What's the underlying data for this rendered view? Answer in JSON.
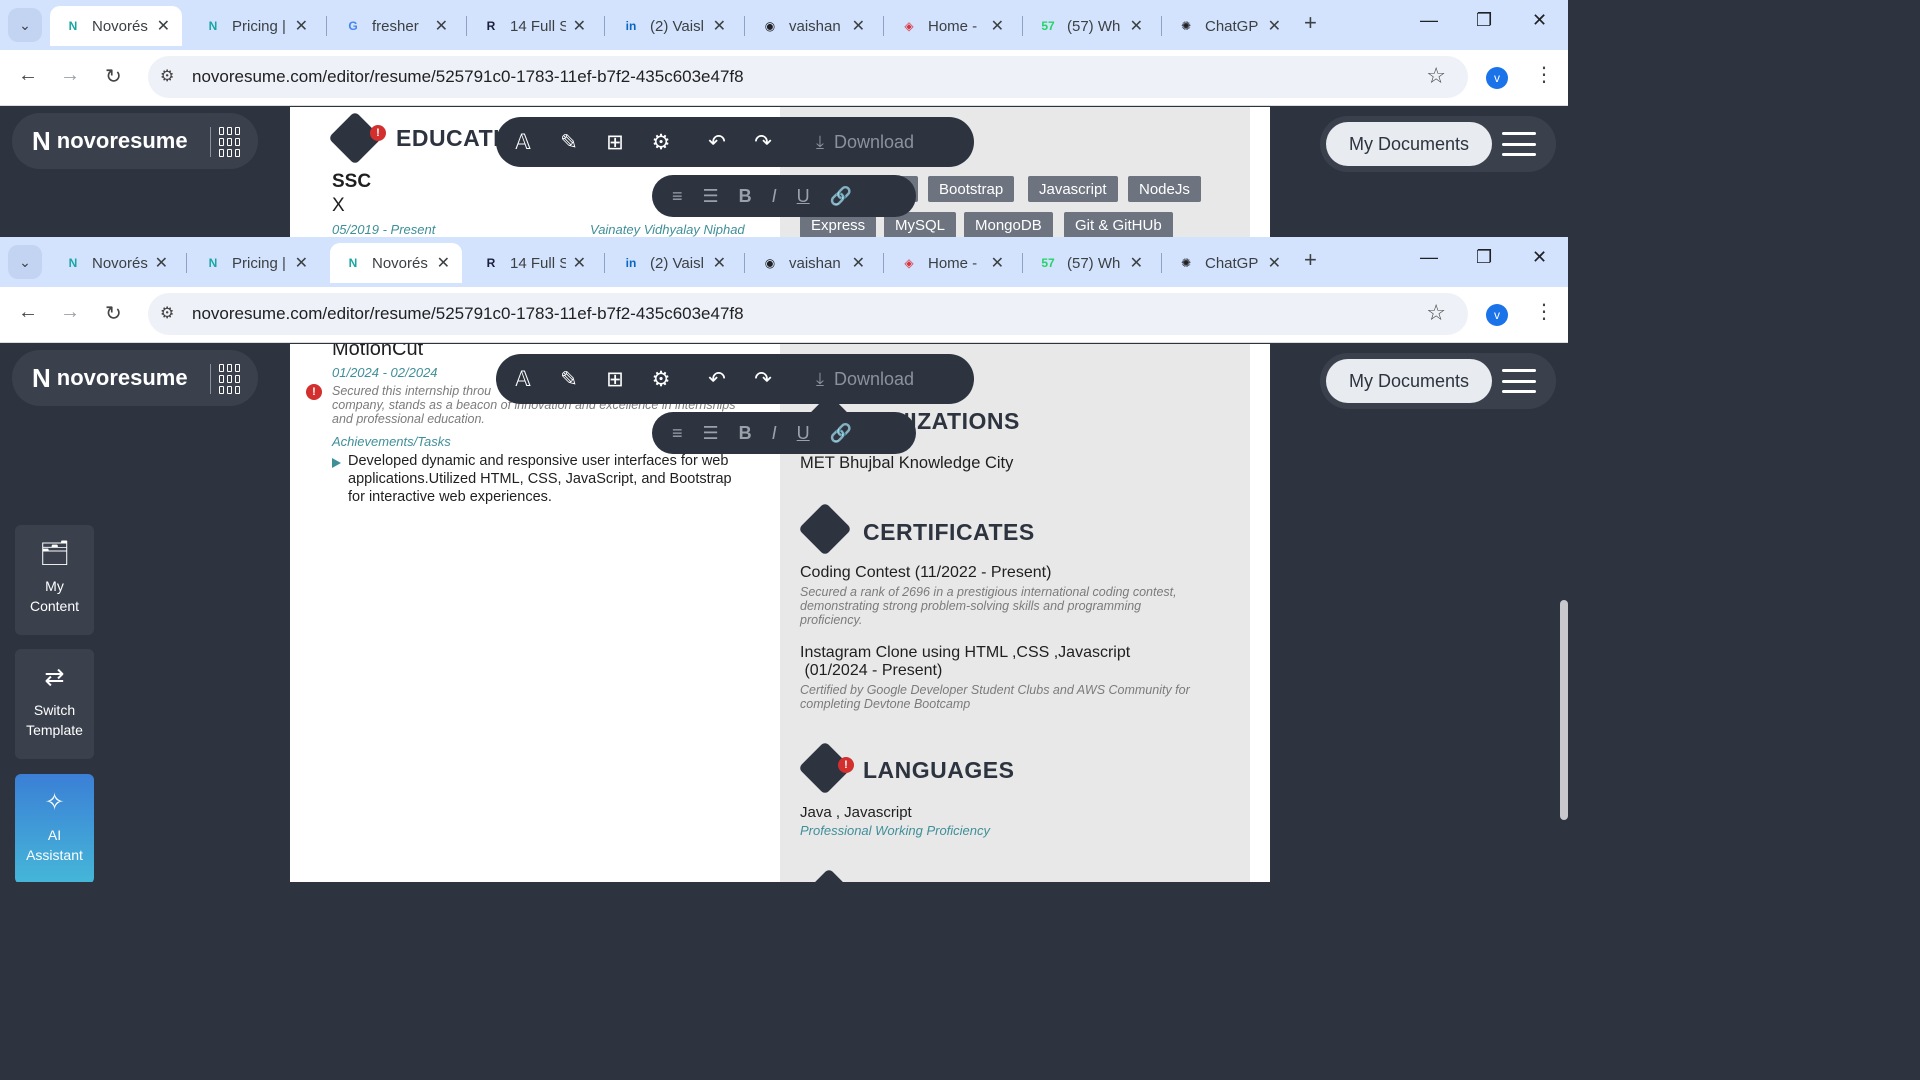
{
  "browser": {
    "tabs_top": [
      {
        "title": "Novorés",
        "favicon": "N",
        "favicon_color": "#1aa5a5",
        "active": true
      },
      {
        "title": "Pricing |",
        "favicon": "N",
        "favicon_color": "#1aa5a5"
      },
      {
        "title": "fresher",
        "favicon": "G",
        "favicon_color": "#4285f4"
      },
      {
        "title": "14 Full S",
        "favicon": "R",
        "favicon_color": "#1b1f3b"
      },
      {
        "title": "(2) Vaisl",
        "favicon": "in",
        "favicon_color": "#0a66c2"
      },
      {
        "title": "vaishan",
        "favicon": "◉",
        "favicon_color": "#202124"
      },
      {
        "title": "Home -",
        "favicon": "◈",
        "favicon_color": "#d9353f"
      },
      {
        "title": "(57) Wh",
        "favicon": "57",
        "favicon_color": "#25d366"
      },
      {
        "title": "ChatGP",
        "favicon": "✺",
        "favicon_color": "#202124"
      }
    ],
    "tabs_bottom": [
      {
        "title": "Novorés",
        "favicon": "N",
        "favicon_color": "#1aa5a5"
      },
      {
        "title": "Pricing |",
        "favicon": "N",
        "favicon_color": "#1aa5a5"
      },
      {
        "title": "Novorés",
        "favicon": "N",
        "favicon_color": "#1aa5a5",
        "active": true
      },
      {
        "title": "14 Full S",
        "favicon": "R",
        "favicon_color": "#1b1f3b"
      },
      {
        "title": "(2) Vaisl",
        "favicon": "in",
        "favicon_color": "#0a66c2"
      },
      {
        "title": "vaishan",
        "favicon": "◉",
        "favicon_color": "#202124"
      },
      {
        "title": "Home -",
        "favicon": "◈",
        "favicon_color": "#d9353f"
      },
      {
        "title": "(57) Wh",
        "favicon": "57",
        "favicon_color": "#25d366"
      },
      {
        "title": "ChatGP",
        "favicon": "✺",
        "favicon_color": "#202124"
      }
    ],
    "url": "novoresume.com/editor/resume/525791c0-1783-11ef-b7f2-435c603e47f8",
    "profile_initial": "v"
  },
  "app": {
    "logo_text": "novoresume",
    "my_documents": "My Documents",
    "download": "Download",
    "side": {
      "my_content": "My Content",
      "switch_template": "Switch Template",
      "ai_assistant": "AI Assistant"
    }
  },
  "top_view": {
    "education_title": "EDUCATI",
    "degree": "SSC",
    "field": "X",
    "dates": "05/2019 - Present",
    "school": "Vainatey  Vidhyalay  Niphad",
    "skills_row1": [
      "Bootstrap",
      "Javascript",
      "NodeJs"
    ],
    "skills_row2": [
      "Express",
      "MySQL",
      "MongoDB",
      "Git & GitHUb"
    ]
  },
  "bottom_view": {
    "company": "MotionCut",
    "dates": "01/2024 - 02/2024",
    "desc_line1": "Secured this internship throu",
    "desc_line2": "company, stands as a beacon of innovation and excellence in internships",
    "desc_line3": "and professional education.",
    "achievements_label": "Achievements/Tasks",
    "bullet_lines": [
      "Developed dynamic and responsive user interfaces for web",
      "applications.Utilized HTML, CSS, JavaScript, and Bootstrap",
      "for interactive web experiences."
    ],
    "organizations_title": "ANIZATIONS",
    "organization": "MET Bhujbal Knowledge City",
    "certificates_title": "CERTIFICATES",
    "cert1_title": "Coding Contest (11/2022 - Present)",
    "cert1_desc": [
      "Secured a rank of 2696 in a prestigious international coding contest,",
      "demonstrating strong problem-solving skills and programming",
      "proficiency."
    ],
    "cert2_title_line1": "Instagram Clone using HTML ,CSS ,Javascript",
    "cert2_title_line2": " (01/2024 - Present)",
    "cert2_desc": [
      "Certified by Google Developer Student Clubs and AWS Community for",
      "completing Devtone Bootcamp"
    ],
    "languages_title": "LANGUAGES",
    "language": "Java , Javascript",
    "language_level": "Professional Working Proficiency"
  }
}
